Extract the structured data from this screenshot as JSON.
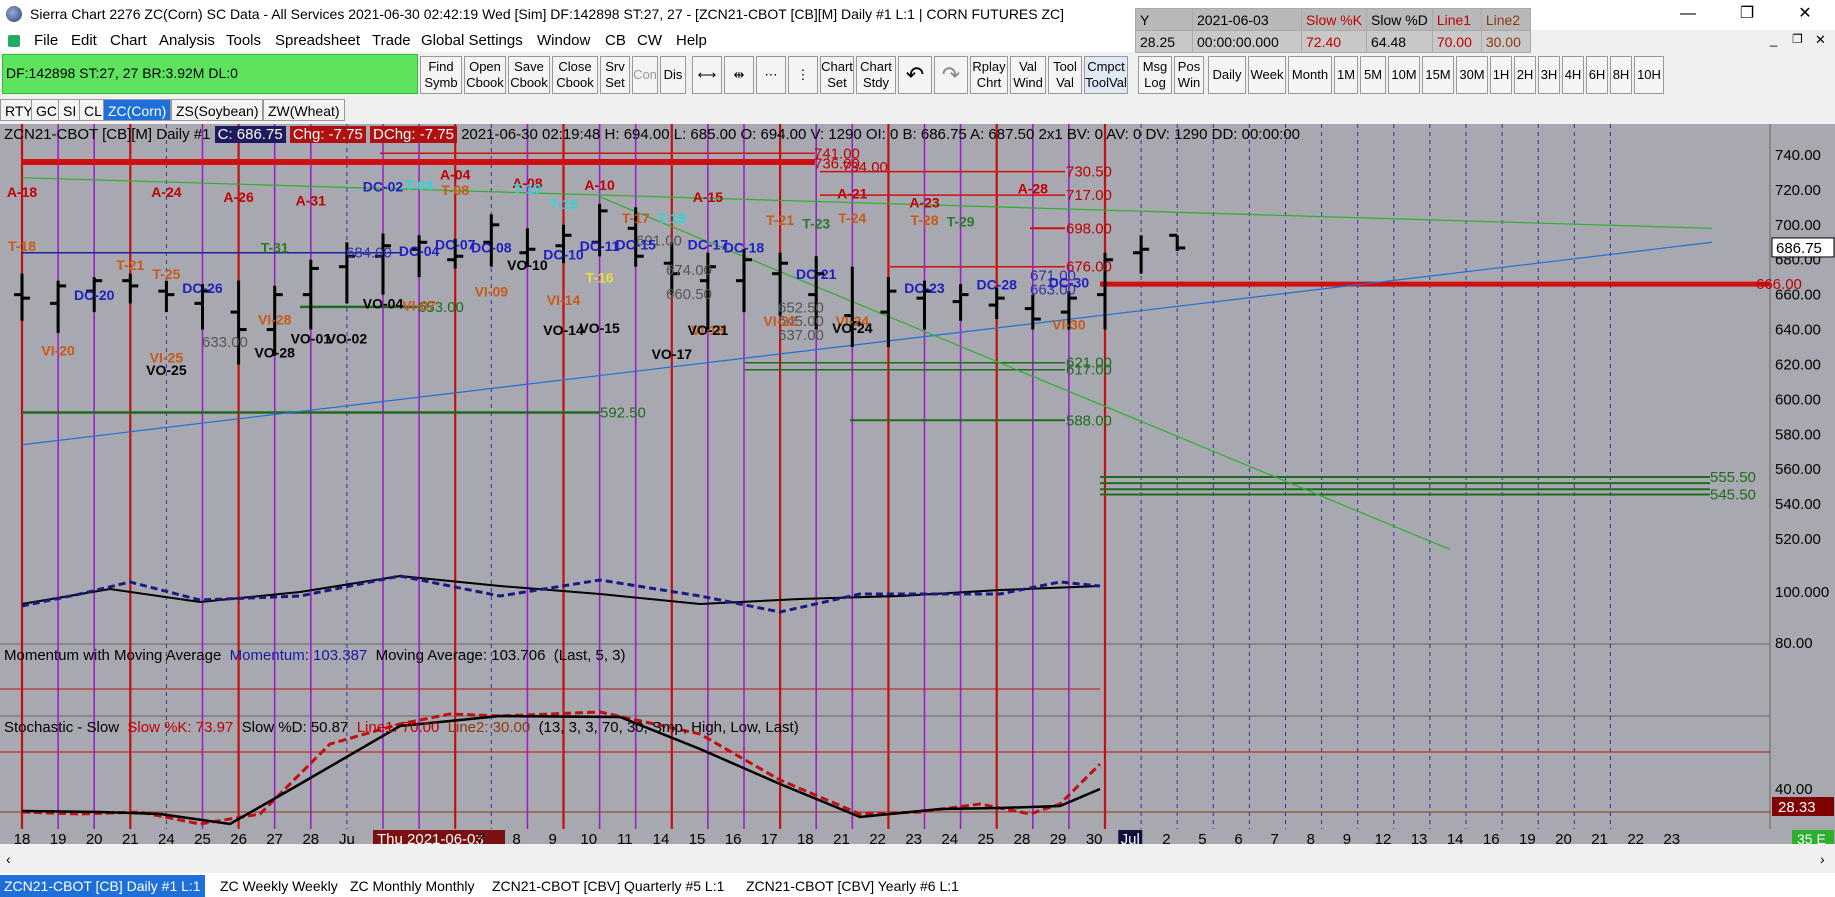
{
  "window": {
    "title": "Sierra Chart 2276 ZC(Corn)  SC Data - All Services 2021-06-30  02:42:19 Wed [Sim]  DF:142898  ST:27, 27 - [ZCN21-CBOT [CB][M]  Daily  #1 L:1 | CORN FUTURES ZC]",
    "minimize": "—",
    "restore": "❐",
    "close": "✕"
  },
  "infogrid": {
    "headers": [
      "Y",
      "2021-06-03",
      "Slow %K",
      "Slow %D",
      "Line1",
      "Line2"
    ],
    "values": [
      "28.25",
      "00:00:00.000",
      "72.40",
      "64.48",
      "70.00",
      "30.00"
    ]
  },
  "menu": [
    "File",
    "Edit",
    "Chart",
    "Analysis",
    "Tools",
    "Spreadsheet",
    "Trade",
    "Global Settings",
    "Window",
    "CB",
    "CW",
    "Help"
  ],
  "status": {
    "text": "DF:142898  ST:27, 27  BR:3.92M  DL:0"
  },
  "toolbar": {
    "buttons": [
      {
        "label": "Find Symb"
      },
      {
        "label": "Open Cbook"
      },
      {
        "label": "Save Cbook"
      },
      {
        "label": "Close Cbook"
      },
      {
        "label": "Srv Set"
      },
      {
        "label": "Con"
      },
      {
        "label": "Dis"
      },
      {
        "label": "Chart Set"
      },
      {
        "label": "Chart Stdy"
      },
      {
        "label": "Rplay Chrt"
      },
      {
        "label": "Val Wind"
      },
      {
        "label": "Tool Val"
      },
      {
        "label": "Cmpct ToolVal"
      },
      {
        "label": "Msg Log"
      },
      {
        "label": "Pos Win"
      }
    ],
    "timeframes": [
      "Daily",
      "Week",
      "Month",
      "1M",
      "5M",
      "10M",
      "15M",
      "30M",
      "1H",
      "2H",
      "3H",
      "4H",
      "6H",
      "8H",
      "10H"
    ]
  },
  "symbol_tabs": [
    "RTY",
    "GC",
    "SI",
    "CL",
    "ZC(Corn)",
    "ZS(Soybean)",
    "ZW(Wheat)"
  ],
  "chart": {
    "header": {
      "symbol": "ZCN21-CBOT [CB][M]  Daily  #1",
      "close": "C: 686.75",
      "chg": "Chg: -7.75",
      "dchg": "DChg: -7.75",
      "rest": "2021-06-30 02:19:48 H: 694.00 L: 685.00 O: 694.00 V: 1290 OI: 0 B: 686.75 A: 687.50 2x1 BV: 0 AV: 0 DV: 1290 DD: 00:00:00"
    },
    "price_labels": [
      "740.00",
      "720.00",
      "700.00",
      "680.00",
      "660.00",
      "640.00",
      "620.00",
      "600.00",
      "580.00",
      "560.00",
      "540.00",
      "520.00"
    ],
    "last_price": "686.75",
    "momentum_labels": [
      "100.000"
    ],
    "stoch_labels": [
      "80.00",
      "40.00"
    ],
    "stoch_last": "28.33",
    "momentum_title": "Momentum with Moving Average",
    "momentum_value": "Momentum: 103.387",
    "momentum_ma": "Moving Average: 103.706",
    "momentum_params": "(Last, 5, 3)",
    "stoch_title": "Stochastic - Slow",
    "stoch_k": "Slow %K: 73.97",
    "stoch_d": "Slow %D: 50.87",
    "stoch_line1": "Line1: 70.00",
    "stoch_line2": "Line2: 30.00",
    "stoch_params": "(13, 3, 3, 70, 30, Smp, High, Low, Last)",
    "date_labels": [
      "18",
      "19",
      "20",
      "21",
      "24",
      "25",
      "26",
      "27",
      "28",
      "Ju",
      "Thu 2021-06-03",
      "7",
      "8",
      "9",
      "10",
      "11",
      "14",
      "15",
      "16",
      "17",
      "18",
      "21",
      "22",
      "23",
      "24",
      "25",
      "28",
      "29",
      "30",
      "Jul",
      "2",
      "5",
      "6",
      "7",
      "8",
      "9",
      "12",
      "13",
      "14",
      "16",
      "19",
      "20",
      "21",
      "22",
      "23"
    ],
    "corner_label": "35 E",
    "level_labels": [
      {
        "text": "741.00",
        "color": "#c00000"
      },
      {
        "text": "736.00",
        "color": "#c00000"
      },
      {
        "text": "734.00",
        "color": "#c00000"
      },
      {
        "text": "730.50",
        "color": "#c00000"
      },
      {
        "text": "717.00",
        "color": "#c00000"
      },
      {
        "text": "698.00",
        "color": "#c00000"
      },
      {
        "text": "676.00",
        "color": "#c00000"
      },
      {
        "text": "666.00",
        "color": "#c00000"
      },
      {
        "text": "621.00",
        "color": "#1f6b1f"
      },
      {
        "text": "617.00",
        "color": "#1f6b1f"
      },
      {
        "text": "592.50",
        "color": "#1f6b1f"
      },
      {
        "text": "588.00",
        "color": "#1f6b1f"
      },
      {
        "text": "555.50",
        "color": "#1f6b1f"
      },
      {
        "text": "545.50",
        "color": "#1f6b1f"
      },
      {
        "text": "684.00",
        "color": "#3030b0"
      },
      {
        "text": "671.00",
        "color": "#3030b0"
      },
      {
        "text": "663.00",
        "color": "#3030b0"
      },
      {
        "text": "653.00",
        "color": "#1f6b1f"
      },
      {
        "text": "691.00",
        "color": "#555"
      },
      {
        "text": "674.00",
        "color": "#555"
      },
      {
        "text": "660.50",
        "color": "#555"
      },
      {
        "text": "652.50",
        "color": "#555"
      },
      {
        "text": "645.00",
        "color": "#555"
      },
      {
        "text": "637.00",
        "color": "#555"
      },
      {
        "text": "633.00",
        "color": "#555"
      }
    ],
    "annotations": [
      {
        "text": "A-18",
        "color": "#c00000"
      },
      {
        "text": "A-24",
        "color": "#c00000"
      },
      {
        "text": "A-26",
        "color": "#c00000"
      },
      {
        "text": "A-31",
        "color": "#c00000"
      },
      {
        "text": "A-04",
        "color": "#c00000"
      },
      {
        "text": "A-08",
        "color": "#c00000"
      },
      {
        "text": "A-10",
        "color": "#c00000"
      },
      {
        "text": "A-15",
        "color": "#c00000"
      },
      {
        "text": "A-21",
        "color": "#c00000"
      },
      {
        "text": "A-23",
        "color": "#c00000"
      },
      {
        "text": "A-28",
        "color": "#c00000"
      },
      {
        "text": "DC-02",
        "color": "#2020c0"
      },
      {
        "text": "DC-20",
        "color": "#2020c0"
      },
      {
        "text": "DC-26",
        "color": "#2020c0"
      },
      {
        "text": "DC-04",
        "color": "#2020c0"
      },
      {
        "text": "DC-07",
        "color": "#2020c0"
      },
      {
        "text": "DC-08",
        "color": "#2020c0"
      },
      {
        "text": "DC-10",
        "color": "#2020c0"
      },
      {
        "text": "DC-11",
        "color": "#2020c0"
      },
      {
        "text": "DC-15",
        "color": "#2020c0"
      },
      {
        "text": "DC-17",
        "color": "#2020c0"
      },
      {
        "text": "DC-18",
        "color": "#2020c0"
      },
      {
        "text": "DC-21",
        "color": "#2020c0"
      },
      {
        "text": "DC-23",
        "color": "#2020c0"
      },
      {
        "text": "DC-28",
        "color": "#2020c0"
      },
      {
        "text": "DC-30",
        "color": "#2020c0"
      },
      {
        "text": "VI-20",
        "color": "#c85a1a"
      },
      {
        "text": "VI-25",
        "color": "#c85a1a"
      },
      {
        "text": "VI-28",
        "color": "#c85a1a"
      },
      {
        "text": "VI-07",
        "color": "#c85a1a"
      },
      {
        "text": "VI-09",
        "color": "#c85a1a"
      },
      {
        "text": "VI-14",
        "color": "#c85a1a"
      },
      {
        "text": "VI-18",
        "color": "#c85a1a"
      },
      {
        "text": "VI-22",
        "color": "#c85a1a"
      },
      {
        "text": "VI-24",
        "color": "#c85a1a"
      },
      {
        "text": "VI-30",
        "color": "#c85a1a"
      },
      {
        "text": "VO-25",
        "color": "#000"
      },
      {
        "text": "VO-28",
        "color": "#000"
      },
      {
        "text": "VO-01",
        "color": "#000"
      },
      {
        "text": "VO-02",
        "color": "#000"
      },
      {
        "text": "VO-04",
        "color": "#000"
      },
      {
        "text": "VO-10",
        "color": "#000"
      },
      {
        "text": "VO-14",
        "color": "#000"
      },
      {
        "text": "VO-15",
        "color": "#000"
      },
      {
        "text": "VO-17",
        "color": "#000"
      },
      {
        "text": "VO-21",
        "color": "#000"
      },
      {
        "text": "VO-24",
        "color": "#000"
      },
      {
        "text": "T-18",
        "color": "#c85a1a"
      },
      {
        "text": "T-21",
        "color": "#c85a1a"
      },
      {
        "text": "T-25",
        "color": "#c85a1a"
      },
      {
        "text": "T-31",
        "color": "#2a7a2a"
      },
      {
        "text": "T-04",
        "color": "#2ad6d6"
      },
      {
        "text": "T-08",
        "color": "#c85a1a"
      },
      {
        "text": "T-10",
        "color": "#2ad6d6"
      },
      {
        "text": "T-15",
        "color": "#2ad6d6"
      },
      {
        "text": "T-16",
        "color": "#e8e040"
      },
      {
        "text": "T-17",
        "color": "#c85a1a"
      },
      {
        "text": "T-18",
        "color": "#2ad6d6"
      },
      {
        "text": "T-21",
        "color": "#c85a1a"
      },
      {
        "text": "T-23",
        "color": "#2a7a2a"
      },
      {
        "text": "T-24",
        "color": "#c85a1a"
      },
      {
        "text": "T-28",
        "color": "#c85a1a"
      },
      {
        "text": "T-29",
        "color": "#2a7a2a"
      }
    ]
  },
  "bottom_tabs": [
    "ZCN21-CBOT [CB]  Daily  #1 L:1",
    "ZC Weekly Weekly",
    "ZC Monthly Monthly",
    "ZCN21-CBOT [CBV]  Quarterly  #5 L:1",
    "ZCN21-CBOT [CBV]  Yearly  #6 L:1"
  ]
}
